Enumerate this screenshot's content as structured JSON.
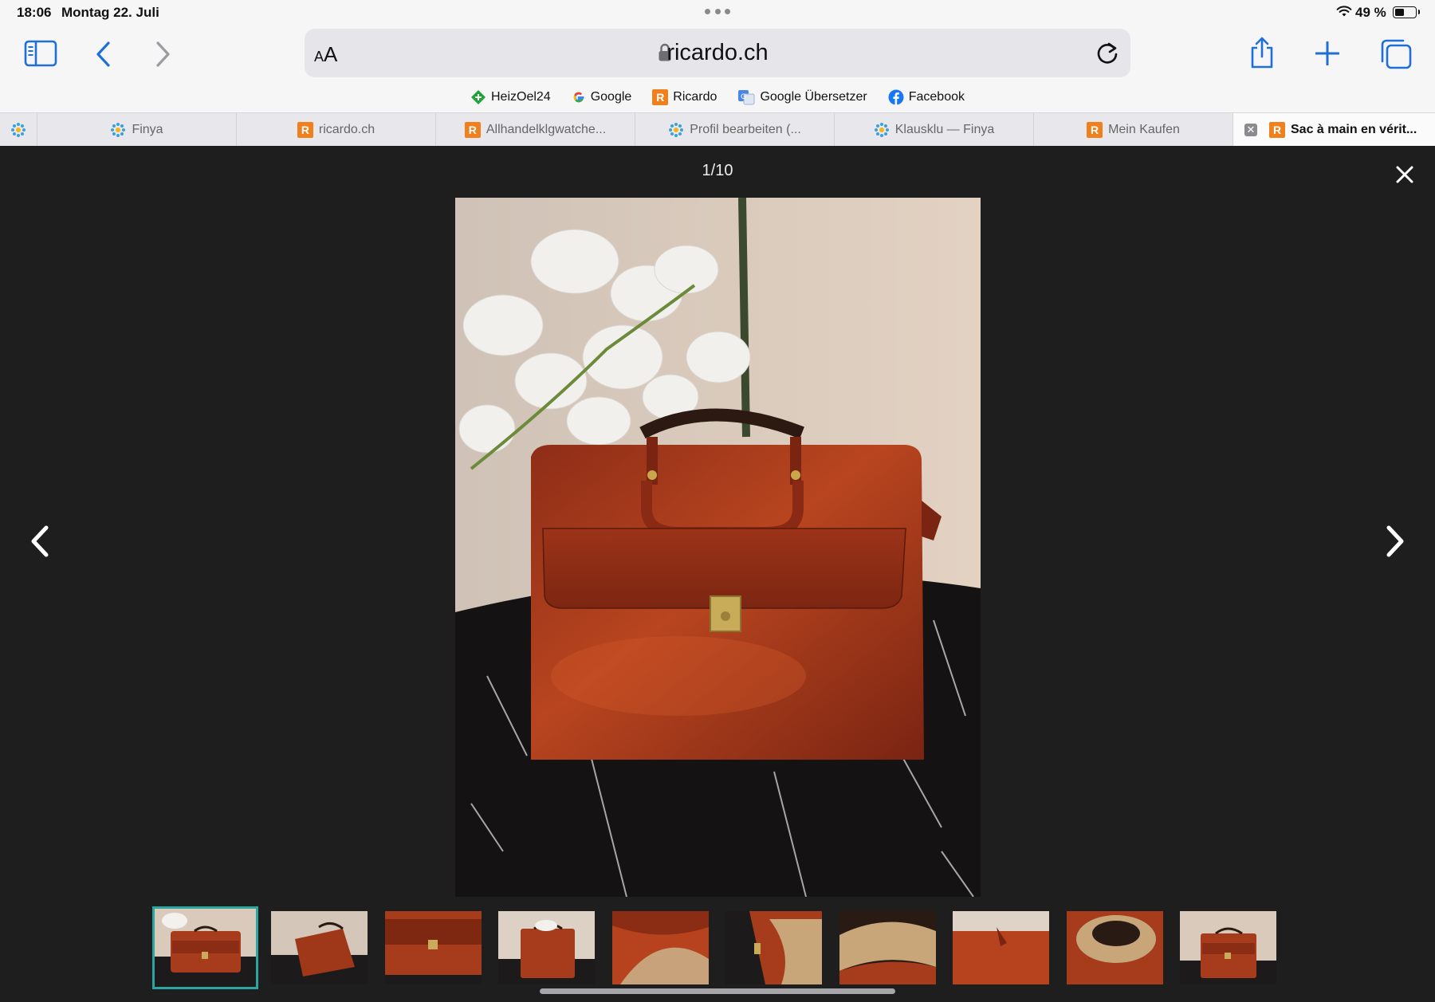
{
  "status_bar": {
    "time": "18:06",
    "date": "Montag 22. Juli",
    "battery": "49 %",
    "battery_level": 0.49
  },
  "toolbar": {
    "aa_label_small": "A",
    "aa_label_big": "A",
    "url": "ricardo.ch"
  },
  "favorites": [
    {
      "label": "HeizOel24",
      "icon": "heizoel-icon"
    },
    {
      "label": "Google",
      "icon": "google-icon"
    },
    {
      "label": "Ricardo",
      "icon": "ricardo-icon"
    },
    {
      "label": "Google Übersetzer",
      "icon": "translate-icon"
    },
    {
      "label": "Facebook",
      "icon": "facebook-icon"
    }
  ],
  "tabs": [
    {
      "label": "Finya"
    },
    {
      "label": "ricardo.ch"
    },
    {
      "label": "Allhandelklgwatche..."
    },
    {
      "label": "Profil bearbeiten (..."
    },
    {
      "label": "Klausklu — Finya"
    },
    {
      "label": "Mein Kaufen"
    },
    {
      "label": "Sac à main en vérit..."
    }
  ],
  "viewer": {
    "counter": "1/10"
  },
  "colors": {
    "accent_teal": "#2aa5a0",
    "ricardo_orange": "#f07f1e",
    "ios_blue": "#1f6fd6"
  }
}
